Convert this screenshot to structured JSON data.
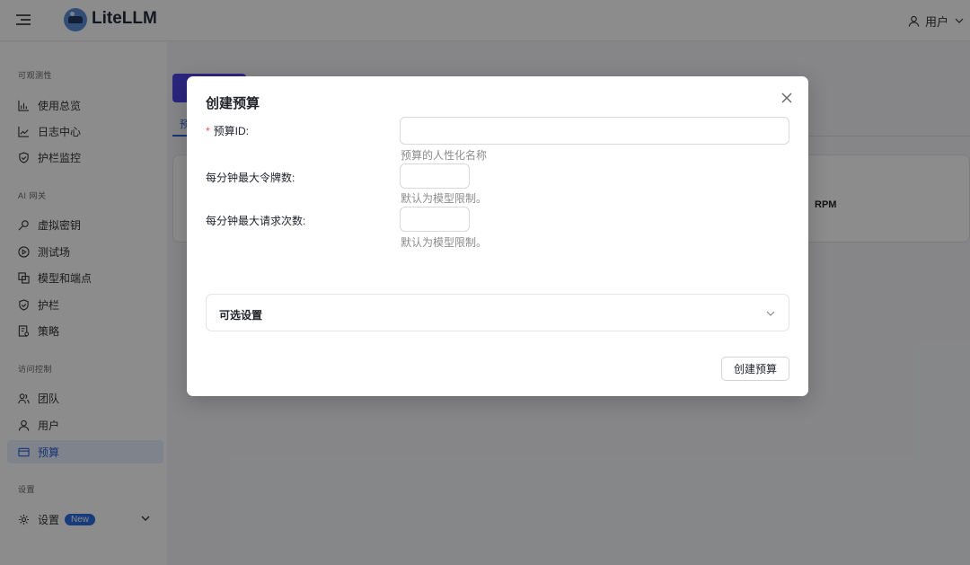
{
  "app": {
    "title": "LiteLLM"
  },
  "header": {
    "user_label": "用户"
  },
  "sidebar": {
    "groups": [
      {
        "title": "可观测性",
        "items": [
          {
            "label": "使用总览",
            "icon": "bar-chart-icon"
          },
          {
            "label": "日志中心",
            "icon": "line-chart-icon"
          },
          {
            "label": "护栏监控",
            "icon": "shield-check-icon"
          }
        ]
      },
      {
        "title": "AI 网关",
        "items": [
          {
            "label": "虚拟密钥",
            "icon": "key-icon"
          },
          {
            "label": "测试场",
            "icon": "play-circle-icon"
          },
          {
            "label": "模型和端点",
            "icon": "layers-icon"
          },
          {
            "label": "护栏",
            "icon": "shield-icon"
          },
          {
            "label": "策略",
            "icon": "policy-icon"
          }
        ]
      },
      {
        "title": "访问控制",
        "items": [
          {
            "label": "团队",
            "icon": "team-icon"
          },
          {
            "label": "用户",
            "icon": "user-icon"
          },
          {
            "label": "预算",
            "icon": "wallet-icon"
          }
        ]
      },
      {
        "title": "设置",
        "items": [
          {
            "label": "设置",
            "icon": "gear-icon",
            "badge": "New"
          }
        ]
      }
    ],
    "active_item": "预算"
  },
  "background": {
    "tab_label": "预",
    "rpm_label": "RPM"
  },
  "modal": {
    "title": "创建预算",
    "fields": [
      {
        "label": "预算ID:",
        "required": true,
        "value": "",
        "help": "预算的人性化名称"
      },
      {
        "label": "每分钟最大令牌数:",
        "required": false,
        "value": "",
        "help": "默认为模型限制。"
      },
      {
        "label": "每分钟最大请求次数:",
        "required": false,
        "value": "",
        "help": "默认为模型限制。"
      }
    ],
    "optional_section_label": "可选设置",
    "submit_label": "创建预算"
  },
  "colors": {
    "accent": "#2a5fd7",
    "primary_button": "#4f46e5",
    "required_star": "#ff4d4f",
    "badge": "#2a6ce0"
  }
}
